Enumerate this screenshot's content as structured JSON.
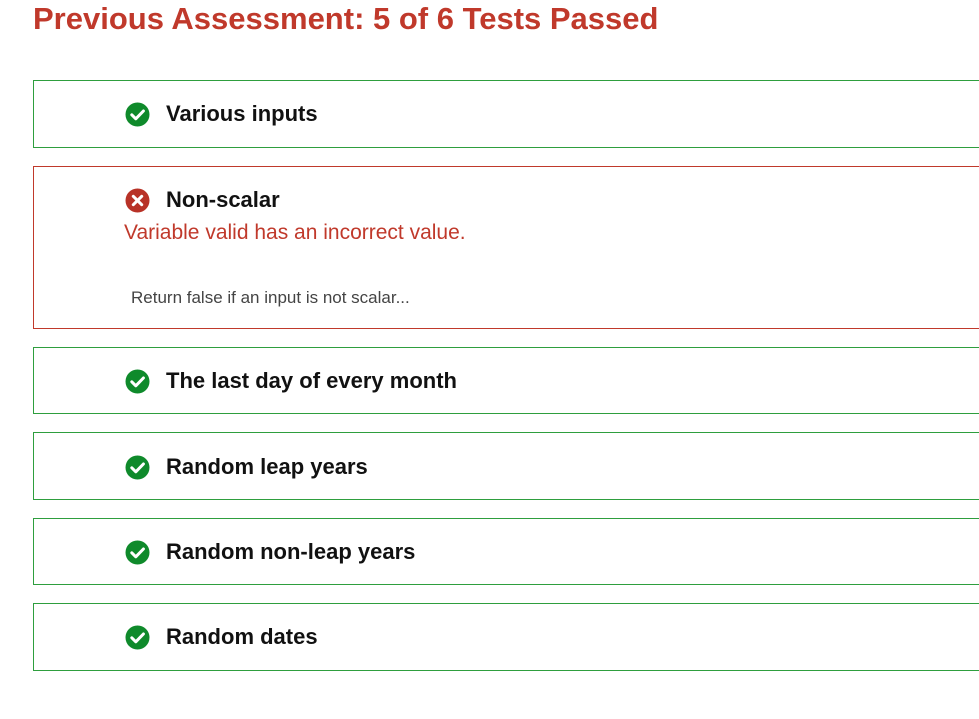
{
  "header": {
    "title": "Previous Assessment: 5 of 6 Tests Passed"
  },
  "colors": {
    "pass": "#0f8a2b",
    "fail": "#b83227",
    "title": "#c0392b"
  },
  "tests": [
    {
      "name": "Various inputs",
      "status": "passed",
      "icon": "check-circle-icon"
    },
    {
      "name": "Non-scalar",
      "status": "failed",
      "icon": "x-circle-icon",
      "message": "Variable valid has an incorrect value.",
      "description": "Return false if an input is not scalar..."
    },
    {
      "name": "The last day of every month",
      "status": "passed",
      "icon": "check-circle-icon"
    },
    {
      "name": "Random leap years",
      "status": "passed",
      "icon": "check-circle-icon"
    },
    {
      "name": "Random non-leap years",
      "status": "passed",
      "icon": "check-circle-icon"
    },
    {
      "name": "Random dates",
      "status": "passed",
      "icon": "check-circle-icon"
    }
  ]
}
